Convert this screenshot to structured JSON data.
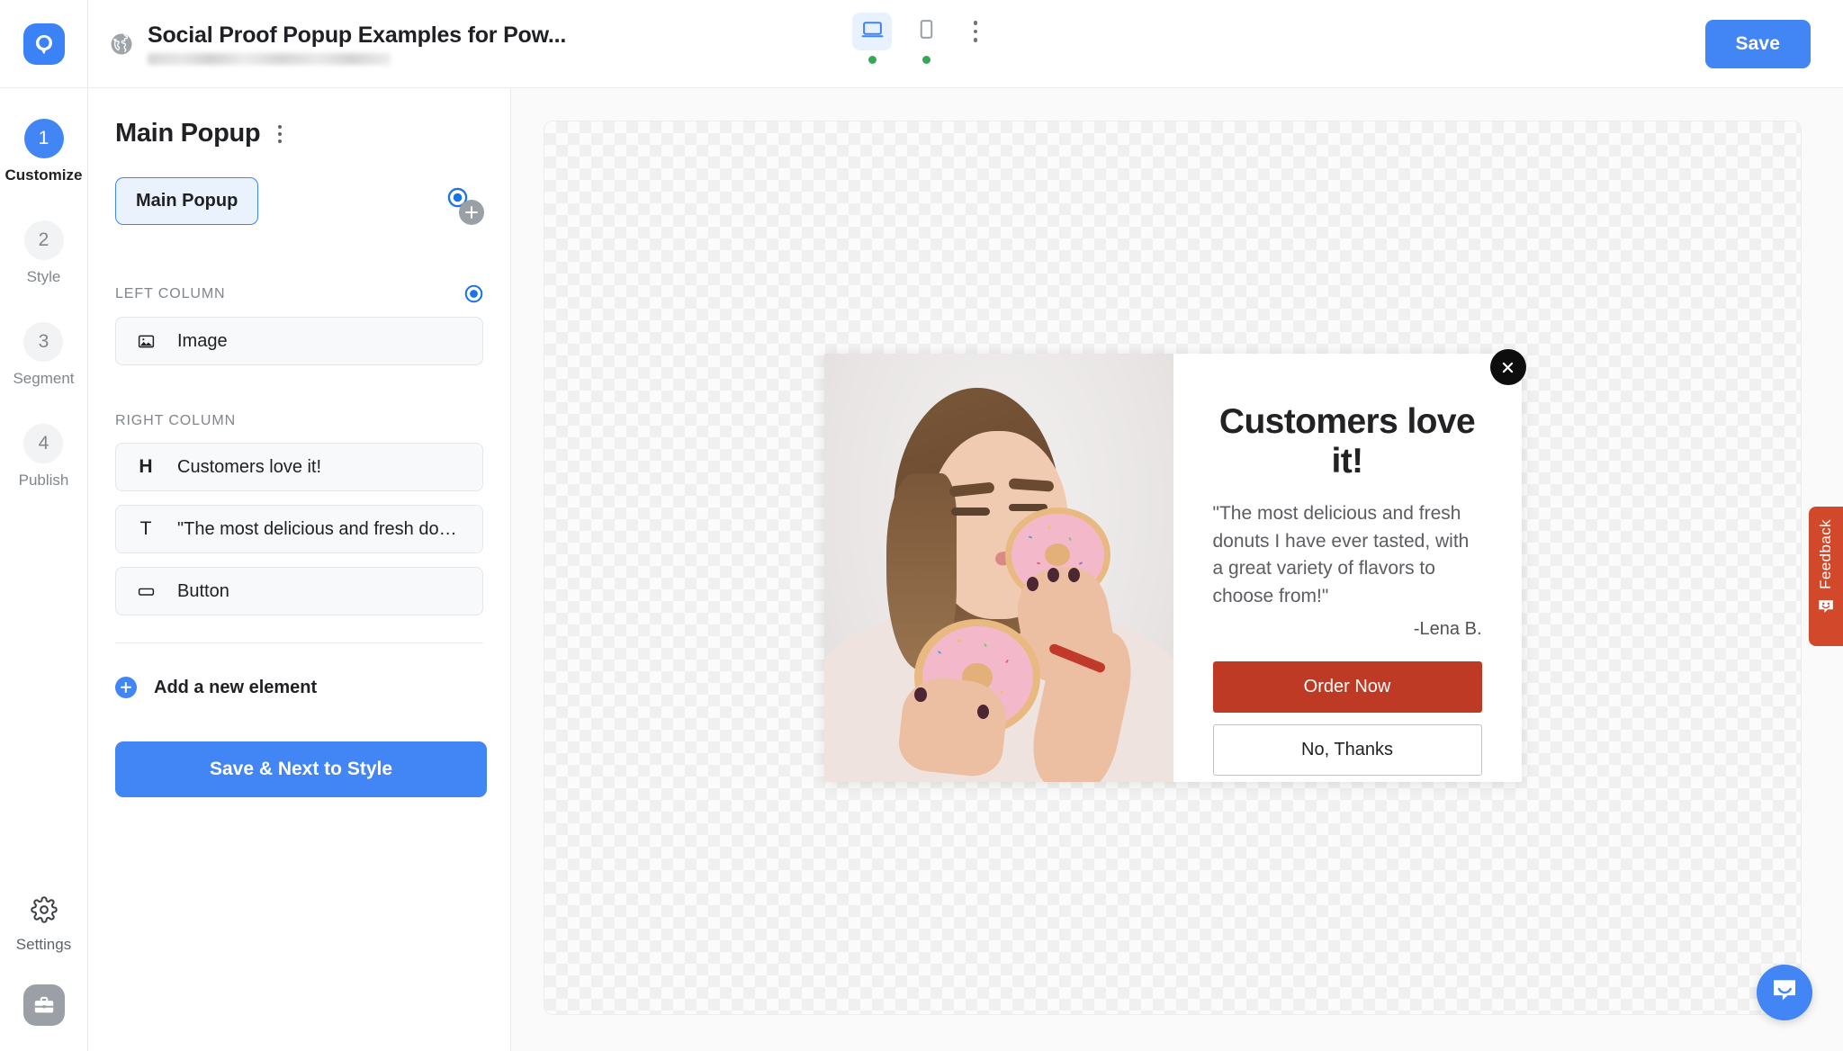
{
  "topbar": {
    "logo_icon": "optimonk-logo-icon",
    "globe_icon": "globe-icon",
    "page_title": "Social Proof Popup Examples for Pow...",
    "url_redacted": "",
    "devices": [
      {
        "icon": "desktop-icon",
        "label": "Desktop",
        "active": true,
        "status": "online"
      },
      {
        "icon": "mobile-icon",
        "label": "Mobile",
        "active": false,
        "status": "online"
      }
    ],
    "more_icon": "kebab-menu-icon",
    "save_label": "Save"
  },
  "rail": {
    "steps": [
      {
        "number": "1",
        "label": "Customize",
        "active": true
      },
      {
        "number": "2",
        "label": "Style",
        "active": false
      },
      {
        "number": "3",
        "label": "Segment",
        "active": false
      },
      {
        "number": "4",
        "label": "Publish",
        "active": false
      }
    ],
    "settings_label": "Settings",
    "settings_icon": "gear-icon",
    "toolbox_icon": "briefcase-icon"
  },
  "panel": {
    "title": "Main Popup",
    "menu_icon": "kebab-menu-icon",
    "radio_icon": "radio-selected-icon",
    "add_icon": "plus-circle-icon",
    "tabs": [
      {
        "label": "Main Popup",
        "active": true
      }
    ],
    "sections": [
      {
        "header": "LEFT COLUMN",
        "has_radio": true,
        "items": [
          {
            "icon": "image-icon",
            "label": "Image"
          }
        ]
      },
      {
        "header": "RIGHT COLUMN",
        "has_radio": false,
        "items": [
          {
            "icon": "heading-icon",
            "label": "Customers love it!"
          },
          {
            "icon": "text-icon",
            "label": "\"The most delicious and fresh donu..."
          },
          {
            "icon": "button-icon",
            "label": "Button"
          }
        ]
      }
    ],
    "add_element_label": "Add a new element",
    "primary_cta": "Save & Next to Style"
  },
  "popup_preview": {
    "close_icon": "close-icon",
    "image_alt": "Woman eating a pink sprinkle donut",
    "heading": "Customers love it!",
    "body": "\"The most delicious and fresh donuts I have ever tasted, with a great variety of flavors to choose from!\"",
    "attribution": "-Lena B.",
    "primary_button": "Order Now",
    "secondary_button": "No, Thanks",
    "primary_button_color": "#bf3a25"
  },
  "feedback": {
    "label": "Feedback",
    "icon": "feedback-smiley-icon",
    "color": "#d1492a"
  },
  "chat": {
    "icon": "chat-bubble-icon",
    "color": "#4285f4"
  },
  "colors": {
    "accent": "#4285f4",
    "accent_soft": "#eaf2fe",
    "muted_text": "#80868b",
    "status_online": "#34a853"
  }
}
